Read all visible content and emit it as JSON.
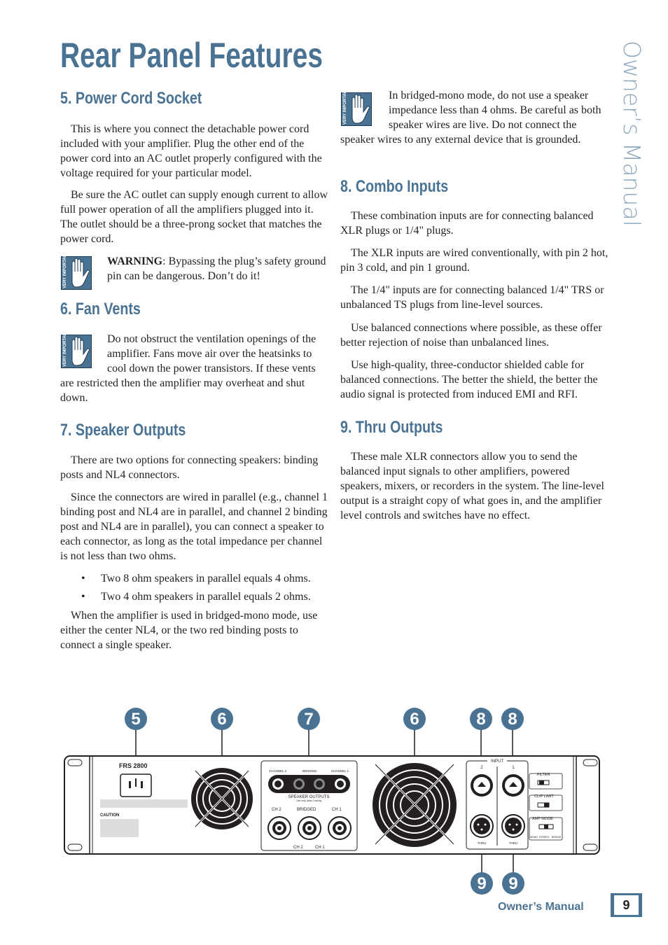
{
  "page": {
    "title": "Rear Panel Features",
    "side_label": "Owner’s Manual",
    "footer": "Owner’s Manual",
    "page_number": "9",
    "accent_color": "#4a7292"
  },
  "left": {
    "s5": {
      "heading": "5. Power Cord Socket",
      "p1": "This is where you connect the detachable power cord included with your amplifier. Plug the other end of the power cord into an AC outlet properly configured with the voltage required for your particular model.",
      "p2": "Be sure the AC outlet can supply enough current to allow full power operation of all the amplifiers plugged into it. The outlet should be a three-prong socket that matches the power cord.",
      "warning_label": "WARNING",
      "warning_text": ": Bypassing the plug’s safety ground pin can be dangerous. Don’t do it!"
    },
    "s6": {
      "heading": "6. Fan Vents",
      "p1": "Do not obstruct the ventilation openings of the amplifier. Fans move air over the heatsinks to cool down the power transistors. If these vents are restricted then the amplifier may overheat and shut down."
    },
    "s7": {
      "heading": "7. Speaker Outputs",
      "p1": "There are two options for connecting speakers: binding posts and NL4 connectors.",
      "p2": "Since the connectors are wired in parallel (e.g., channel 1 binding post and NL4 are in parallel, and channel 2 binding post and NL4 are in parallel), you can connect a speaker to each connector, as long as the total impedance per channel is not less than two ohms.",
      "bullets": [
        "Two 8 ohm speakers in parallel equals 4 ohms.",
        "Two 4 ohm speakers in parallel equals 2 ohms."
      ],
      "p3": "When the amplifier is used in bridged-mono mode, use either the center NL4, or the two red binding posts to connect a single speaker."
    }
  },
  "right": {
    "note": "In bridged-mono mode, do not use a speaker impedance less than 4 ohms. Be careful as both speaker wires are live. Do not connect the speaker wires to any external device that is grounded.",
    "s8": {
      "heading": "8. Combo Inputs",
      "paragraphs": [
        "These combination inputs are for connecting balanced XLR plugs or 1/4\" plugs.",
        "The XLR inputs are wired conventionally, with pin 2 hot, pin 3 cold, and pin 1 ground.",
        "The 1/4\" inputs are for connecting balanced 1/4\" TRS or unbalanced TS plugs from line-level sources.",
        "Use balanced connections where possible, as these offer better rejection of noise than unbalanced lines.",
        "Use high-quality, three-conductor shielded cable for balanced connections. The better the shield, the better the audio signal is protected from induced EMI and RFI."
      ]
    },
    "s9": {
      "heading": "9. Thru Outputs",
      "p1": "These male XLR connectors allow you to send the balanced input signals to other amplifiers, powered speakers, mixers, or recorders in the system. The line-level output is a straight copy of what goes in, and the amplifier level controls and switches have no effect."
    }
  },
  "icons": {
    "very_important": "VERY IMPORTANT",
    "icon": "hand-stop-icon"
  },
  "diagram": {
    "callouts_top": [
      "5",
      "6",
      "7",
      "6",
      "8",
      "8"
    ],
    "callouts_bottom": [
      "9",
      "9"
    ],
    "model": "FRS 2800",
    "caution": "CAUTION",
    "channel2": "CHANNEL 2",
    "bridged": "BRIDGED",
    "channel1": "CHANNEL 1",
    "speaker_outputs": "SPEAKER OUTPUTS",
    "speaker_outputs_sub": "Use only class 2 wiring",
    "ch2": "CH 2",
    "ch1": "CH 1",
    "bridged_nl4": "BRIDGED",
    "input": "INPUT",
    "in2": "2",
    "in1": "1",
    "thru": "THRU",
    "filter": "FILTER",
    "clip_limit": "CLIP LIMIT",
    "amp_mode": "AMP MODE",
    "off": "OFF",
    "on": "ON",
    "mono": "MONO",
    "stereo": "STEREO",
    "bridge": "BRIDGE"
  }
}
